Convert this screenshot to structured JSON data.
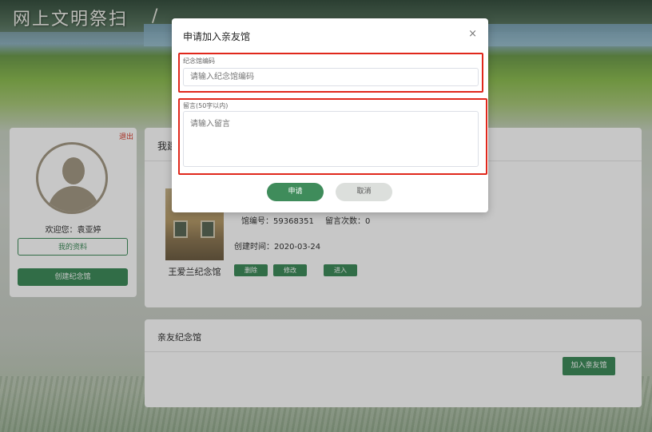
{
  "site": {
    "title": "网上文明祭扫"
  },
  "user_panel": {
    "logout_label": "退出",
    "welcome_text": "欢迎您：袁亚婷",
    "my_profile_label": "我的资料",
    "create_memorial_label": "创建纪念馆"
  },
  "my_memorials": {
    "title": "我建",
    "memorial": {
      "name": "王爱兰纪念馆",
      "hall_no_text": "馆编号：59368351",
      "message_count_text": "留言次数：0",
      "created_text": "创建时间：2020-03-24",
      "delete_label": "删除",
      "edit_label": "修改",
      "enter_label": "进入"
    }
  },
  "friends": {
    "title": "亲友纪念馆",
    "join_label": "加入亲友馆"
  },
  "dialog": {
    "title": "申请加入亲友馆",
    "close_glyph": "×",
    "code_label": "纪念馆编码",
    "code_placeholder": "请输入纪念馆编码",
    "message_label": "留言(50字以内)",
    "message_placeholder": "请输入留言",
    "submit_label": "申请",
    "cancel_label": "取消"
  },
  "colors": {
    "accent": "#3f8c5b",
    "highlight": "#e0281c"
  }
}
